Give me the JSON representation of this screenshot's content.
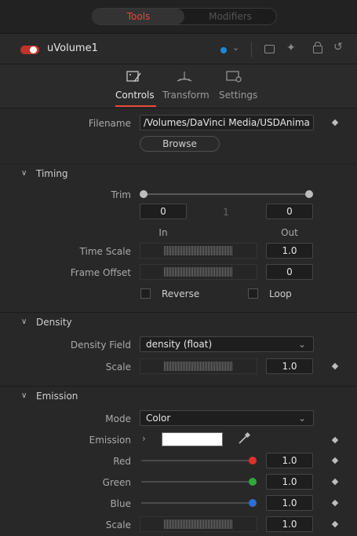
{
  "top_tabs": {
    "tools": "Tools",
    "modifiers": "Modifiers"
  },
  "tool": {
    "name": "uVolume1",
    "color_dot": "#1e88d8"
  },
  "section_tabs": [
    {
      "label": "Controls",
      "icon": "controls-icon"
    },
    {
      "label": "Transform",
      "icon": "transform-icon"
    },
    {
      "label": "Settings",
      "icon": "settings-icon"
    }
  ],
  "file": {
    "label": "Filename",
    "value": "/Volumes/DaVinci Media/USDAnima",
    "browse": "Browse"
  },
  "timing": {
    "title": "Timing",
    "trim_label": "Trim",
    "trim_in": "0",
    "trim_mid": "1",
    "trim_out": "0",
    "in_label": "In",
    "out_label": "Out",
    "time_scale_label": "Time Scale",
    "time_scale": "1.0",
    "frame_offset_label": "Frame Offset",
    "frame_offset": "0",
    "reverse_label": "Reverse",
    "loop_label": "Loop"
  },
  "density": {
    "title": "Density",
    "field_label": "Density Field",
    "field_value": "density (float)",
    "scale_label": "Scale",
    "scale_value": "1.0"
  },
  "emission": {
    "title": "Emission",
    "mode_label": "Mode",
    "mode_value": "Color",
    "emission_label": "Emission",
    "red_label": "Red",
    "red_value": "1.0",
    "red_color": "#e0302a",
    "green_label": "Green",
    "green_value": "1.0",
    "green_color": "#2eaa3a",
    "blue_label": "Blue",
    "blue_value": "1.0",
    "blue_color": "#2c6fd8",
    "scale_label": "Scale",
    "scale_value": "1.0"
  }
}
